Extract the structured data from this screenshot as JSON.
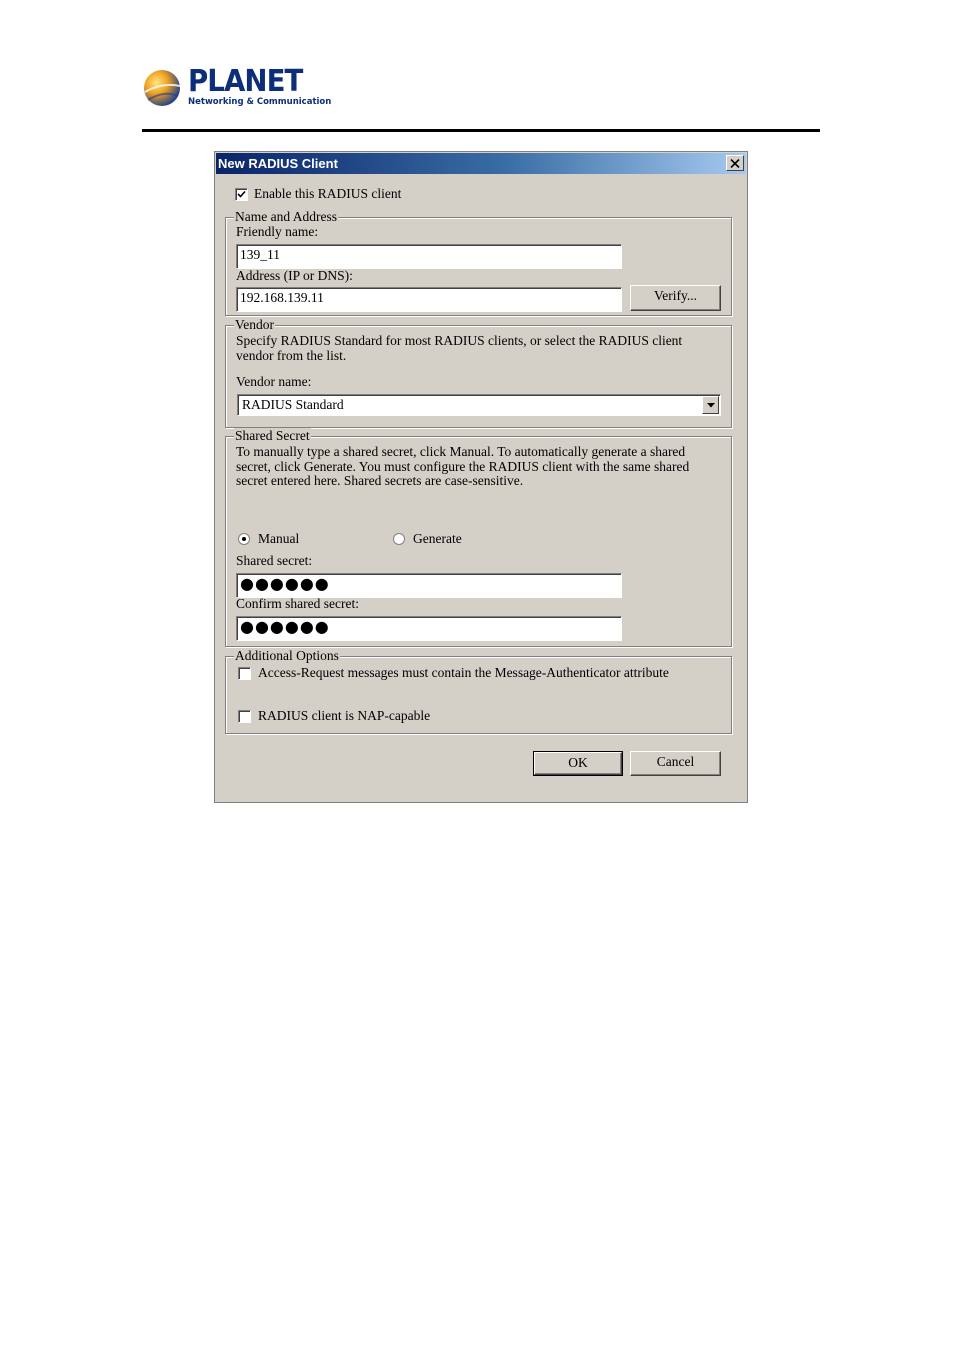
{
  "brand": {
    "name": "PLANET",
    "tagline": "Networking & Communication"
  },
  "dialog": {
    "title": "New RADIUS Client",
    "enable_label": "Enable this RADIUS client",
    "enable_checked": true,
    "name_address": {
      "legend": "Name and Address",
      "friendly_label": "Friendly name:",
      "friendly_value": "139_11",
      "address_label": "Address (IP or DNS):",
      "address_value": "192.168.139.11",
      "verify_label": "Verify..."
    },
    "vendor": {
      "legend": "Vendor",
      "description": "Specify RADIUS Standard for most RADIUS clients, or select the RADIUS client vendor from the list.",
      "name_label": "Vendor name:",
      "selected": "RADIUS Standard"
    },
    "shared_secret": {
      "legend": "Shared Secret",
      "description": "To manually type a shared secret, click Manual. To automatically generate a shared secret, click Generate. You must configure the RADIUS client with the same shared secret entered here. Shared secrets are case-sensitive.",
      "manual_label": "Manual",
      "generate_label": "Generate",
      "selected_option": "Manual",
      "secret_label": "Shared secret:",
      "secret_value": "●●●●●●",
      "confirm_label": "Confirm shared secret:",
      "confirm_value": "●●●●●●"
    },
    "additional": {
      "legend": "Additional Options",
      "message_auth_label": "Access-Request messages must contain the Message-Authenticator attribute",
      "message_auth_checked": false,
      "nap_label": "RADIUS client is NAP-capable",
      "nap_checked": false
    },
    "ok_label": "OK",
    "cancel_label": "Cancel"
  },
  "colors": {
    "dialog_face": "#d4d0c8",
    "titlebar_start": "#0a246a",
    "titlebar_end": "#a6caf0",
    "brand_blue": "#0d2f7a"
  },
  "icons": [
    "planet-globe-icon",
    "close-icon",
    "checkmark-icon",
    "dropdown-arrow-icon"
  ]
}
